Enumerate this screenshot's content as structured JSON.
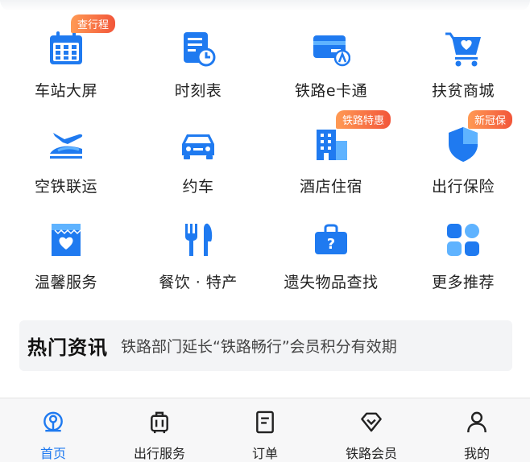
{
  "colors": {
    "primary": "#1f7af0",
    "light_blue": "#5fb3ff",
    "badge": "#f2563a",
    "text": "#222222"
  },
  "services": [
    {
      "label": "车站大屏",
      "icon": "calendar-grid-icon",
      "badge": "查行程"
    },
    {
      "label": "时刻表",
      "icon": "timetable-clock-icon",
      "badge": ""
    },
    {
      "label": "铁路e卡通",
      "icon": "card-icon",
      "badge": ""
    },
    {
      "label": "扶贫商城",
      "icon": "shopping-cart-heart-icon",
      "badge": ""
    },
    {
      "label": "空铁联运",
      "icon": "plane-train-icon",
      "badge": ""
    },
    {
      "label": "约车",
      "icon": "car-icon",
      "badge": ""
    },
    {
      "label": "酒店住宿",
      "icon": "hotel-building-icon",
      "badge": "铁路特惠"
    },
    {
      "label": "出行保险",
      "icon": "shield-icon",
      "badge": "新冠保"
    },
    {
      "label": "温馨服务",
      "icon": "heart-box-icon",
      "badge": ""
    },
    {
      "label": "餐饮 · 特产",
      "icon": "fork-knife-icon",
      "badge": ""
    },
    {
      "label": "遗失物品查找",
      "icon": "lost-item-bag-icon",
      "badge": ""
    },
    {
      "label": "更多推荐",
      "icon": "more-grid-icon",
      "badge": ""
    }
  ],
  "news": {
    "title": "热门资讯",
    "text": "铁路部门延长“铁路畅行”会员积分有效期"
  },
  "tabs": [
    {
      "label": "首页",
      "icon": "home-train-icon",
      "active": true
    },
    {
      "label": "出行服务",
      "icon": "luggage-icon",
      "active": false
    },
    {
      "label": "订单",
      "icon": "order-list-icon",
      "active": false
    },
    {
      "label": "铁路会员",
      "icon": "diamond-icon",
      "active": false
    },
    {
      "label": "我的",
      "icon": "user-icon",
      "active": false
    }
  ]
}
